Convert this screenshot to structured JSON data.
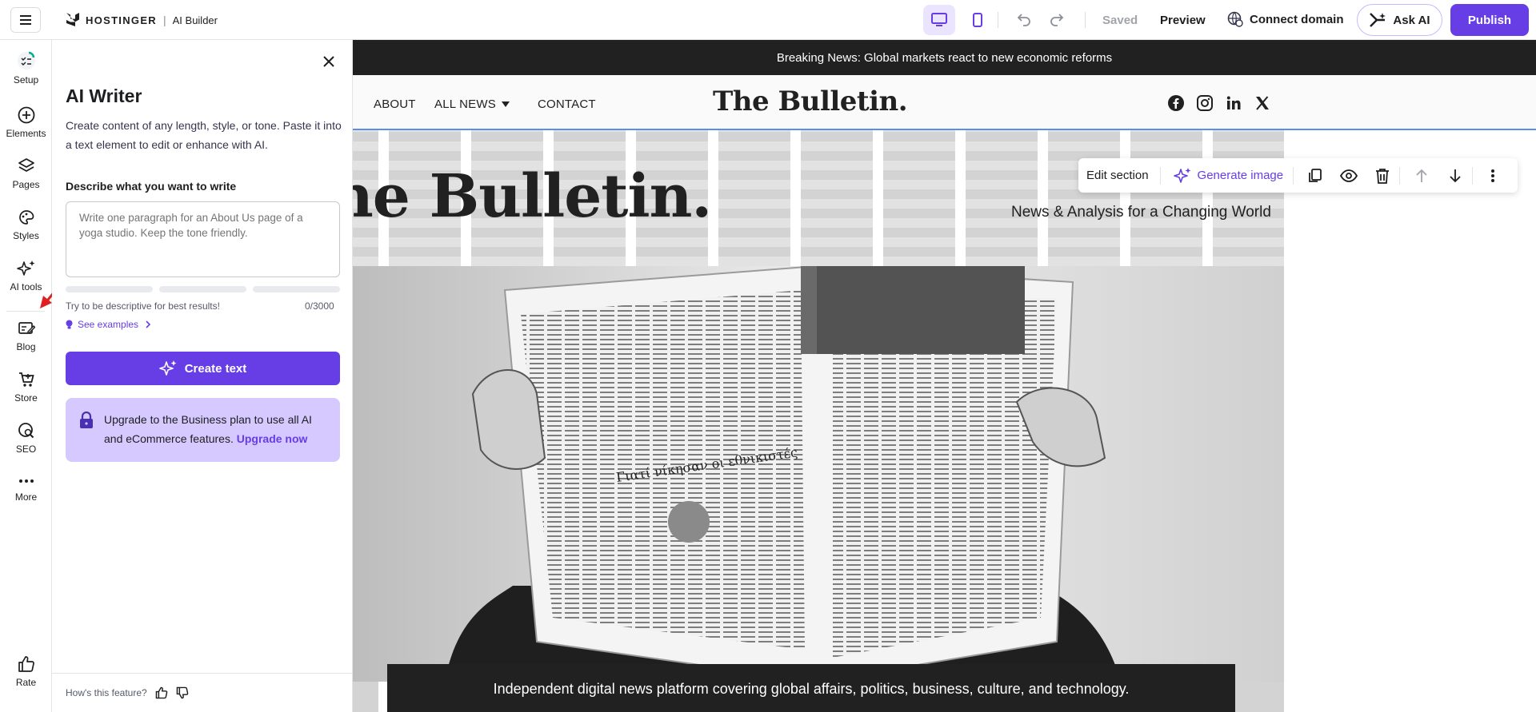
{
  "topbar": {
    "logo_text": "HOSTINGER",
    "logo_sub": "AI Builder",
    "saved": "Saved",
    "preview": "Preview",
    "connect_domain": "Connect domain",
    "ask_ai": "Ask AI",
    "publish": "Publish"
  },
  "rail": {
    "items": [
      {
        "label": "Setup",
        "icon": "setup-icon"
      },
      {
        "label": "Elements",
        "icon": "plus-circle-icon"
      },
      {
        "label": "Pages",
        "icon": "layers-icon"
      },
      {
        "label": "Styles",
        "icon": "palette-icon"
      },
      {
        "label": "AI tools",
        "icon": "sparkles-icon"
      },
      {
        "label": "Blog",
        "icon": "blog-icon"
      },
      {
        "label": "Store",
        "icon": "cart-icon"
      },
      {
        "label": "SEO",
        "icon": "seo-icon"
      },
      {
        "label": "More",
        "icon": "more-icon"
      },
      {
        "label": "Rate",
        "icon": "thumbs-up-icon"
      }
    ]
  },
  "panel": {
    "title": "AI Writer",
    "description": "Create content of any length, style, or tone. Paste it into a text element to edit or enhance with AI.",
    "field_label": "Describe what you want to write",
    "placeholder": "Write one paragraph for an About Us page of a yoga studio. Keep the tone friendly.",
    "hint": "Try to be descriptive for best results!",
    "counter": "0/3000",
    "examples_link": "See examples",
    "create_button": "Create text",
    "upgrade_text": "Upgrade to the Business plan to use all AI and eCommerce features.",
    "upgrade_link": "Upgrade now",
    "feedback_text": "How's this feature?"
  },
  "site": {
    "breaking": "Breaking News: Global markets react to new economic reforms",
    "nav": [
      "ABOUT",
      "ALL NEWS",
      "CONTACT"
    ],
    "logo": "The Bulletin.",
    "hero_title": "he Bulletin.",
    "hero_subtitle": "News & Analysis for a Changing World",
    "caption": "Independent digital news platform covering global affairs, politics, business, culture, and technology.",
    "social": [
      "facebook-icon",
      "instagram-icon",
      "linkedin-icon",
      "x-icon"
    ]
  },
  "section_toolbar": {
    "edit_section": "Edit section",
    "generate_image": "Generate image"
  },
  "colors": {
    "accent": "#673de6",
    "upgrade_bg": "#d5c9ff",
    "dark": "#212121",
    "section_outline": "#5b8def"
  }
}
